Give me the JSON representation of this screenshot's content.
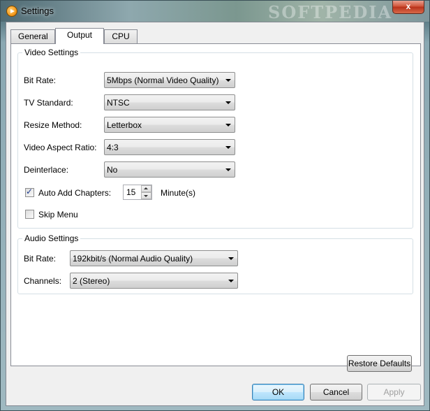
{
  "window": {
    "title": "Settings",
    "close_label": "x",
    "watermark": "SOFTPEDIA"
  },
  "tabs": [
    {
      "label": "General"
    },
    {
      "label": "Output"
    },
    {
      "label": "CPU"
    }
  ],
  "video": {
    "group_title": "Video Settings",
    "bit_rate_label": "Bit Rate:",
    "bit_rate_value": "5Mbps (Normal Video Quality)",
    "tv_standard_label": "TV Standard:",
    "tv_standard_value": "NTSC",
    "resize_method_label": "Resize Method:",
    "resize_method_value": "Letterbox",
    "aspect_ratio_label": "Video Aspect Ratio:",
    "aspect_ratio_value": "4:3",
    "deinterlace_label": "Deinterlace:",
    "deinterlace_value": "No",
    "auto_chapters_label": "Auto Add Chapters:",
    "auto_chapters_checked": true,
    "auto_chapters_value": "15",
    "auto_chapters_unit": "Minute(s)",
    "skip_menu_label": "Skip Menu",
    "skip_menu_checked": false
  },
  "audio": {
    "group_title": "Audio Settings",
    "bit_rate_label": "Bit Rate:",
    "bit_rate_value": "192kbit/s (Normal Audio Quality)",
    "channels_label": "Channels:",
    "channels_value": "2 (Stereo)"
  },
  "buttons": {
    "restore_defaults": "Restore Defaults",
    "ok": "OK",
    "cancel": "Cancel",
    "apply": "Apply"
  }
}
